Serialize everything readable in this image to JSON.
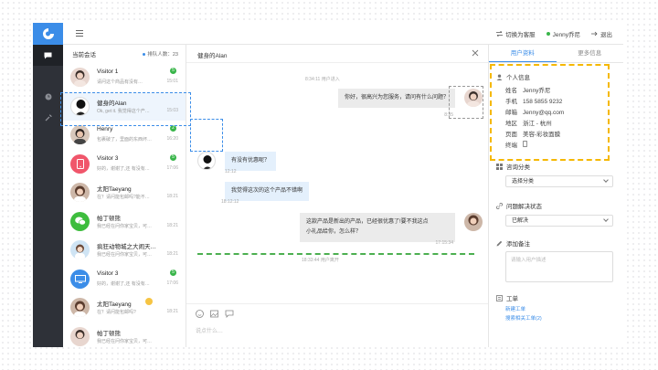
{
  "topbar": {
    "switch_label": "切换为客服",
    "user_name": "Jenny乔尼",
    "logout_label": "退出"
  },
  "list": {
    "title": "当前会话",
    "queue_label": "排队人数：23",
    "items": [
      {
        "name": "Visitor 1",
        "preview": "请问这个商品有没有…",
        "time": "15:01",
        "badge": "5"
      },
      {
        "name": "健身的Alan",
        "preview": "Ok, get it. 我觉得这个产…",
        "time": "15:03",
        "badge": ""
      },
      {
        "name": "Henry",
        "preview": "包裹破了，里面的东西坏…",
        "time": "16:20",
        "badge": "2"
      },
      {
        "name": "Visitor 3",
        "preview": "好的，谢谢了,还 有没有…",
        "time": "17:06",
        "badge": "5"
      },
      {
        "name": "太阳Taeyang",
        "preview": "在？请问能包邮吗?能不…",
        "time": "18:21",
        "badge": ""
      },
      {
        "name": "帕丁顿熊",
        "preview": "我已经在问你家宝贝，可…",
        "time": "18:21",
        "badge": ""
      },
      {
        "name": "疯狂动物城之大闹天…",
        "preview": "我已经在问你家宝贝，可…",
        "time": "18:21",
        "badge": ""
      },
      {
        "name": "Visitor 3",
        "preview": "好的，谢谢了,还 有没有…",
        "time": "17:06",
        "badge": "5"
      },
      {
        "name": "太阳Taeyang",
        "preview": "在？请问能包邮吗?",
        "time": "18:21",
        "badge": ""
      },
      {
        "name": "帕丁顿熊",
        "preview": "我已经在问你家宝贝，可…",
        "time": "18:21",
        "badge": ""
      }
    ]
  },
  "chat": {
    "title": "健身的Alan",
    "sys_join": "8:34:11 用户进入",
    "msg1": "你好，很高兴为您服务，请问有什么问题？",
    "msg1_time": "8:35",
    "msg2": "有没有优惠呢？",
    "msg2_time": "12:12",
    "msg3": "我觉得这次的这个产品不错啊",
    "msg3_time": "18:12:12",
    "msg4_line1": "这款产品是新出的产品，已经很优惠了!要不我这点",
    "msg4_line2": "小礼品给你，怎么样？",
    "msg4_time": "17:15:34",
    "sys_leave": "18:33:44 用户离开",
    "input_placeholder": "说点什么…"
  },
  "panel": {
    "tab_profile": "用户资料",
    "tab_more": "更多信息",
    "info_title": "个人信息",
    "info": [
      {
        "label": "姓名",
        "value": "Jenny乔尼"
      },
      {
        "label": "手机",
        "value": "158 5855 9232"
      },
      {
        "label": "邮箱",
        "value": "Jenny@qq.com"
      },
      {
        "label": "地区",
        "value": "浙江 - 杭州"
      },
      {
        "label": "页面",
        "value": "美容-彩妆面膜"
      },
      {
        "label": "终端",
        "value": ""
      }
    ],
    "category_title": "咨询分类",
    "category_value": "选择分类",
    "status_title": "问题解决状态",
    "status_value": "已解决",
    "note_title": "添加备注",
    "note_placeholder": "请输入用户描述",
    "ticket_title": "工单",
    "ticket_new": "新建工单",
    "ticket_search": "搜索相关工单(2)"
  }
}
